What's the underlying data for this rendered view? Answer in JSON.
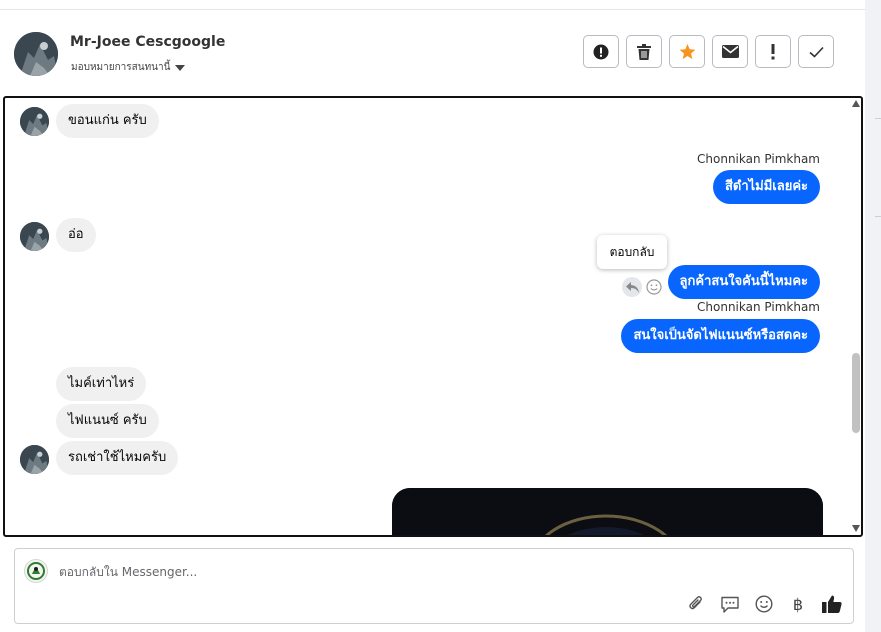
{
  "header": {
    "contact_name": "Mr-Joee Cescgoogle",
    "assign_label": "มอบหมายการสนทนานี้",
    "toolbar": [
      {
        "name": "alert-circle-button",
        "icon": "exclamation-circle-icon"
      },
      {
        "name": "delete-button",
        "icon": "trash-icon"
      },
      {
        "name": "star-button",
        "icon": "star-icon",
        "color": "#f7931e"
      },
      {
        "name": "mail-button",
        "icon": "envelope-icon"
      },
      {
        "name": "important-button",
        "icon": "exclamation-icon"
      },
      {
        "name": "done-button",
        "icon": "checkmark-icon"
      }
    ]
  },
  "messages": [
    {
      "dir": "in",
      "text": "ขอนแก่น ครับ",
      "avatar": true
    },
    {
      "dir": "out",
      "sender": "Chonnikan Pimkham",
      "text": "สีดำไม่มีเลยค่ะ"
    },
    {
      "dir": "in",
      "text": "อ่อ",
      "avatar": true
    },
    {
      "dir": "out",
      "text": "ลูกค้าสนใจคันนี้ไหมคะ"
    },
    {
      "dir": "out",
      "sender": "Chonnikan Pimkham",
      "text": "สนใจเป็นจัดไฟแนนซ์หรือสดคะ"
    },
    {
      "dir": "in",
      "text": "ไมค์เท่าไหร่",
      "avatar": false
    },
    {
      "dir": "in",
      "text": "ไฟแนนซ์ ครับ",
      "avatar": false
    },
    {
      "dir": "in",
      "text": "รถเช่าใช้ไหมครับ",
      "avatar": true
    }
  ],
  "tooltip": {
    "text": "ตอบกลับ"
  },
  "composer": {
    "placeholder": "ตอบกลับใน Messenger...",
    "icons": [
      "paperclip-icon",
      "saved-reply-icon",
      "emoji-icon",
      "baht-icon",
      "thumbs-up-icon"
    ],
    "baht_symbol": "฿"
  },
  "colors": {
    "outgoing_bubble": "#0866ff",
    "incoming_bubble": "#f0f0f0",
    "star": "#f7931e"
  }
}
